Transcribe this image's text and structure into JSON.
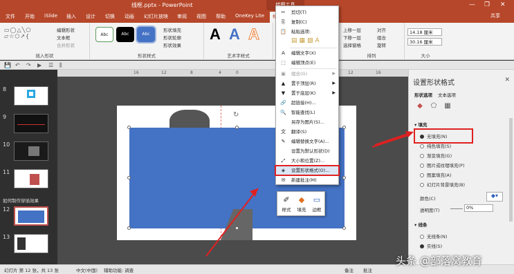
{
  "window": {
    "title": "线框.pptx - PowerPoint",
    "context_tab": "绘图工具",
    "controls": [
      "—",
      "❐",
      "✕"
    ]
  },
  "tabs": [
    "文件",
    "开始",
    "iSlide",
    "插入",
    "设计",
    "切换",
    "动画",
    "幻灯片放映",
    "审阅",
    "视图",
    "帮助",
    "OneKey Lite",
    "格式"
  ],
  "share": "共享",
  "ribbon": {
    "insert_shapes": {
      "label": "插入形状",
      "edit_shape": "编辑形状",
      "textbox": "文本框",
      "merge_shapes": "合并形状"
    },
    "shape_styles": {
      "label": "形状样式",
      "swatch_text": "Abc",
      "fill": "形状填充",
      "outline": "形状轮廓",
      "effects": "形状效果"
    },
    "wordart": {
      "label": "艺术字样式",
      "letter": "A"
    },
    "arrange": {
      "label": "排列",
      "bring_forward": "上移一层",
      "send_backward": "下移一层",
      "selection_pane": "选择窗格",
      "align": "对齐",
      "group": "组合",
      "rotate": "旋转"
    },
    "size": {
      "label": "大小",
      "height": "14.18 厘米",
      "width": "30.16 厘米"
    }
  },
  "thumbnails": [
    {
      "num": "8"
    },
    {
      "num": "9"
    },
    {
      "num": "10"
    },
    {
      "num": "11"
    },
    {
      "num": "12"
    },
    {
      "num": "13"
    }
  ],
  "section_label": "如何制作穿插效果",
  "ruler_marks": [
    "16",
    "12",
    "8",
    "4",
    "0",
    "4",
    "8",
    "12",
    "16"
  ],
  "context_menu": {
    "items": [
      {
        "icon": "✂",
        "label": "剪切(T)"
      },
      {
        "icon": "⎘",
        "label": "复制(C)"
      },
      {
        "icon": "📋",
        "label": "粘贴选项:"
      },
      {
        "icon": "A",
        "label": "编辑文字(X)"
      },
      {
        "icon": "⬚",
        "label": "编辑顶点(E)"
      },
      {
        "icon": "▣",
        "label": "组合(G)"
      },
      {
        "icon": "▲",
        "label": "置于顶层(R)"
      },
      {
        "icon": "▼",
        "label": "置于底层(K)"
      },
      {
        "icon": "🔗",
        "label": "超链接(H)..."
      },
      {
        "icon": "🔍",
        "label": "智能查找(L)"
      },
      {
        "icon": "",
        "label": "另存为图片(S)..."
      },
      {
        "icon": "文",
        "label": "翻译(S)"
      },
      {
        "icon": "✎",
        "label": "编辑替换文字(A)..."
      },
      {
        "icon": "",
        "label": "设置为默认形状(D)"
      },
      {
        "icon": "⤢",
        "label": "大小和位置(Z)..."
      },
      {
        "icon": "◈",
        "label": "设置形状格式(O)..."
      },
      {
        "icon": "✉",
        "label": "新建批注(M)"
      }
    ]
  },
  "mini_toolbar": [
    {
      "icon": "✐",
      "label": "样式"
    },
    {
      "icon": "◆",
      "label": "填充"
    },
    {
      "icon": "▭",
      "label": "边框"
    }
  ],
  "pane": {
    "title": "设置形状格式",
    "tabs": [
      "形状选项",
      "文本选项"
    ],
    "fill_section": "填充",
    "fill_options": [
      {
        "label": "无填充(N)",
        "on": true
      },
      {
        "label": "纯色填充(S)",
        "on": false
      },
      {
        "label": "渐变填充(G)",
        "on": false
      },
      {
        "label": "图片或纹理填充(P)",
        "on": false
      },
      {
        "label": "图案填充(A)",
        "on": false
      },
      {
        "label": "幻灯片背景填充(B)",
        "on": false
      }
    ],
    "color_label": "颜色(C)",
    "transparency_label": "透明度(T)",
    "transparency_value": "0%",
    "line_section": "线条",
    "line_options": [
      {
        "label": "无线条(N)",
        "on": false
      },
      {
        "label": "实线(S)",
        "on": true
      }
    ]
  },
  "status": {
    "slide": "幻灯片 第 12 张，共 13 张",
    "lang": "中文(中国)",
    "accessibility": "辅助功能: 调查",
    "notes": "备注",
    "comments": "批注"
  },
  "watermark": "头条 @部落窝教育",
  "colors": {
    "accent": "#b7472a",
    "shape": "#4472c4",
    "highlight": "#e02020"
  }
}
